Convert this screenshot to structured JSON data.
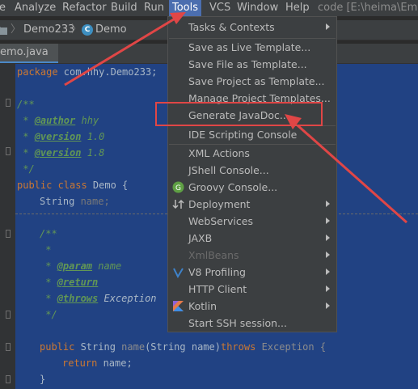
{
  "menubar": {
    "items": [
      {
        "label": "e"
      },
      {
        "label": "Analyze"
      },
      {
        "label": "Refactor"
      },
      {
        "label": "Build"
      },
      {
        "label": "Run"
      },
      {
        "label": "Tools"
      },
      {
        "label": "VCS"
      },
      {
        "label": "Window"
      },
      {
        "label": "Help"
      }
    ],
    "project_title": "code [E:\\heima\\Emplo"
  },
  "navbar": {
    "crumb_project": "Demo233",
    "crumb_class": "Demo",
    "class_icon_letter": "C"
  },
  "tab": {
    "label": "emo.java"
  },
  "code": {
    "package_kw": "package",
    "package_name": " com.hhy.Demo233;",
    "doc_open": "/**",
    "doc_star": " * ",
    "author_tag": "@author",
    "author_val": " hhy",
    "version_tag": "@version",
    "version1_val": " 1.0",
    "version2_val": " 1.8",
    "doc_close": " */",
    "class_kw": "public class",
    "class_name": " Demo {",
    "field_type": "String",
    "field_name": " name;",
    "m_doc_open": "/**",
    "m_star": " *",
    "m_star2": " * ",
    "param_tag": "@param",
    "param_val": " name",
    "return_tag": "@return",
    "throws_tag": "@throws",
    "throws_val": " Exception",
    "m_doc_close": " */",
    "sig_kw": "public",
    "sig_type": " String ",
    "sig_name": "name",
    "sig_params": "(String name)",
    "sig_throws": "throws",
    "sig_exc": " Exception {",
    "ret_kw": "return",
    "ret_val": " name;",
    "close_brace": "}"
  },
  "tools_menu": {
    "items": [
      {
        "label": "Tasks & Contexts",
        "submenu": true
      },
      {
        "label": "Save as Live Template..."
      },
      {
        "label": "Save File as Template..."
      },
      {
        "label": "Save Project as Template..."
      },
      {
        "label": "Manage Project Templates..."
      },
      {
        "label": "Generate JavaDoc..."
      },
      {
        "label": "IDE Scripting Console"
      },
      {
        "label": "XML Actions"
      },
      {
        "label": "JShell Console..."
      },
      {
        "label": "Groovy Console..."
      },
      {
        "label": "Deployment",
        "submenu": true
      },
      {
        "label": "WebServices",
        "submenu": true
      },
      {
        "label": "JAXB",
        "submenu": true
      },
      {
        "label": "XmlBeans",
        "submenu": true,
        "disabled": true
      },
      {
        "label": "V8 Profiling",
        "submenu": true
      },
      {
        "label": "HTTP Client",
        "submenu": true
      },
      {
        "label": "Kotlin",
        "submenu": true
      },
      {
        "label": "Start SSH session..."
      }
    ]
  },
  "icons": {
    "groovy": "groovy-icon",
    "deployment": "deployment-icon",
    "v8": "v8-icon",
    "kotlin": "kotlin-icon",
    "class": "class-icon",
    "folder": "folder-icon"
  },
  "colors": {
    "accent": "#4b6eaf",
    "annotation_red": "#e04646",
    "selection": "#214283",
    "menu_bg": "#3c3f41"
  }
}
